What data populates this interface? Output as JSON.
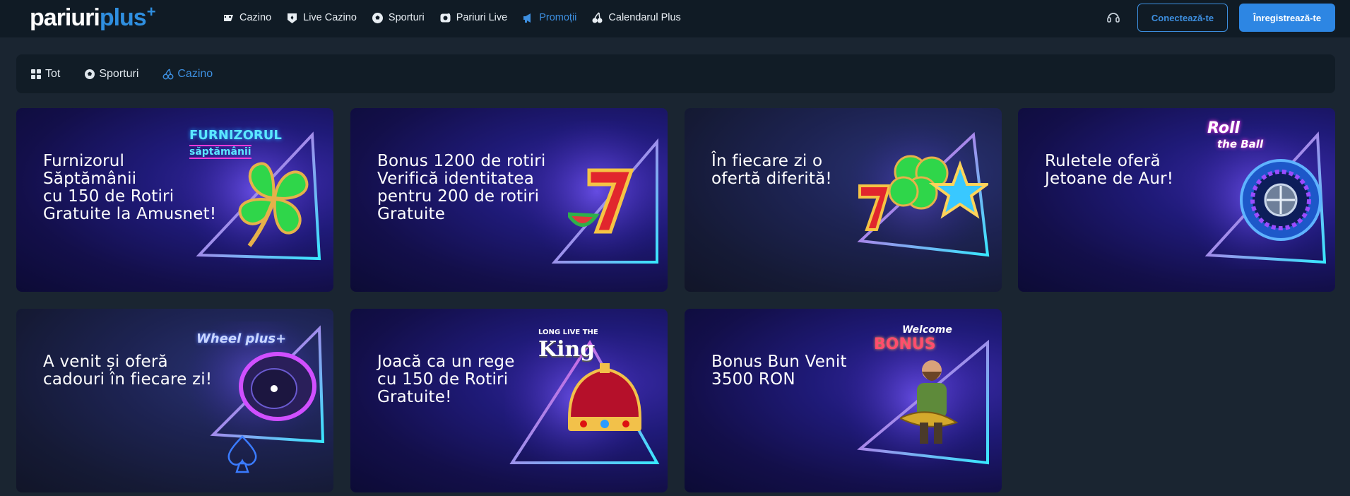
{
  "header": {
    "logo": {
      "part1": "pariuri",
      "part2": "plus",
      "sup": "+"
    },
    "nav": [
      {
        "label": "Cazino",
        "icon": "cazino-icon",
        "active": false
      },
      {
        "label": "Live Cazino",
        "icon": "live-cazino-icon",
        "active": false
      },
      {
        "label": "Sporturi",
        "icon": "football-icon",
        "active": false
      },
      {
        "label": "Pariuri Live",
        "icon": "live-bet-icon",
        "active": false
      },
      {
        "label": "Promoții",
        "icon": "megaphone-icon",
        "active": true
      },
      {
        "label": "Calendarul Plus",
        "icon": "cherries-icon",
        "active": false
      }
    ],
    "login_label": "Conectează-te",
    "register_label": "Înregistrează-te"
  },
  "filters": [
    {
      "label": "Tot",
      "icon": "grid-icon",
      "active": false
    },
    {
      "label": "Sporturi",
      "icon": "football-icon",
      "active": false
    },
    {
      "label": "Cazino",
      "icon": "cherries-icon",
      "active": true
    }
  ],
  "promotions": [
    {
      "title": "Furnizorul\nSăptămânii\ncu 150 de Rotiri\nGratuite la Amusnet!",
      "badge": "FURNIZORUL",
      "badge2": "săptămânii"
    },
    {
      "title": "Bonus 1200 de rotiri\nVerifică identitatea\npentru 200 de rotiri\nGratuite"
    },
    {
      "title": "În fiecare zi o\nofertă diferită!"
    },
    {
      "title": "Ruletele oferă\nJetoane de Aur!",
      "badge": "Roll",
      "badge2": "the Ball"
    },
    {
      "title": "A venit și oferă\ncadouri în fiecare zi!",
      "badge": "Wheel plus+"
    },
    {
      "title": "Joacă ca un rege\ncu 150 de Rotiri\nGratuite!",
      "badge": "LONG LIVE THE",
      "badge2": "King"
    },
    {
      "title": "Bonus Bun Venit\n3500 RON",
      "badge": "Welcome",
      "badge2": "BONUS"
    }
  ],
  "colors": {
    "accent": "#2d86e3",
    "bg": "#1a2531",
    "header": "#101b25"
  }
}
